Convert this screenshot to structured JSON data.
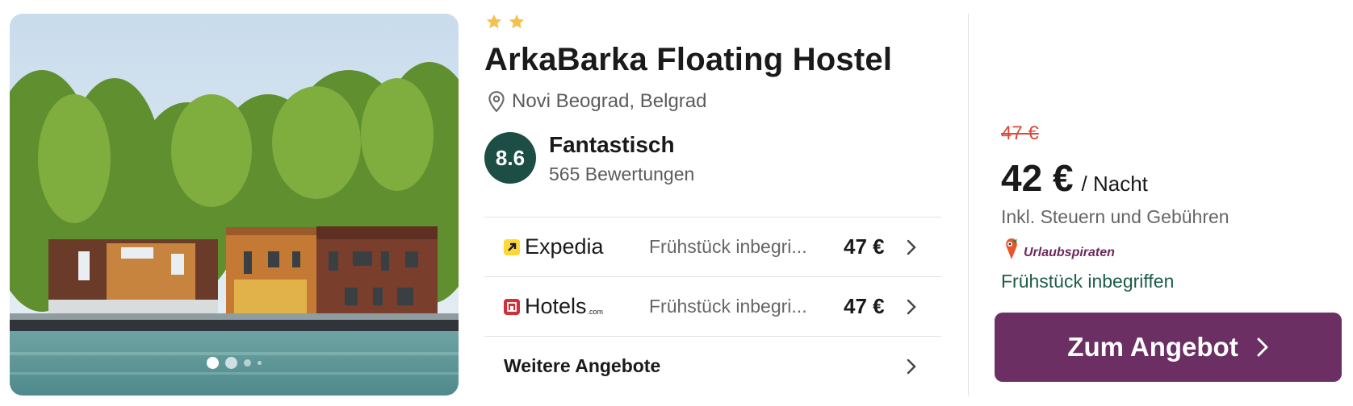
{
  "hotel": {
    "stars": 2,
    "name": "ArkaBarka Floating Hostel",
    "location": "Novi Beograd, Belgrad",
    "rating_score": "8.6",
    "rating_word": "Fantastisch",
    "rating_count": "565 Bewertungen"
  },
  "gallery": {
    "slide_count": 4,
    "active_index": 0
  },
  "offers": [
    {
      "provider": "Expedia",
      "description": "Frühstück inbegri...",
      "price": "47 €"
    },
    {
      "provider": "Hotels",
      "provider_suffix": ".com",
      "description": "Frühstück inbegri...",
      "price": "47 €"
    }
  ],
  "more_offers_label": "Weitere Angebote",
  "deal": {
    "old_price": "47 €",
    "price": "42 €",
    "per_night": "/ Nacht",
    "tax_note": "Inkl. Steuern und Gebühren",
    "partner": "Urlaubspiraten",
    "perk": "Frühstück inbegriffen",
    "cta_label": "Zum Angebot"
  },
  "colors": {
    "rating_badge": "#1d4e45",
    "cta": "#6b2f63",
    "old_price": "#d84a3a",
    "perk": "#1d5c4a",
    "star": "#f2c14e"
  },
  "icons": [
    "star-icon",
    "map-pin-icon",
    "expedia-logo-icon",
    "hotels-logo-icon",
    "chevron-right-icon",
    "pirate-logo-icon"
  ]
}
